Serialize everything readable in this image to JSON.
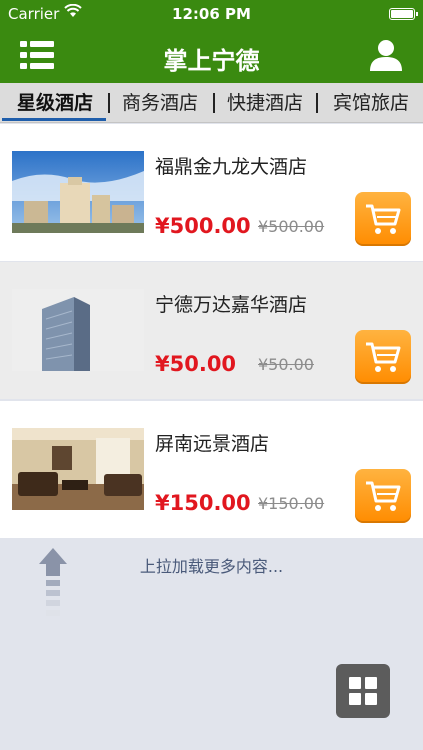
{
  "status_bar": {
    "carrier": "Carrier",
    "time": "12:06 PM"
  },
  "nav": {
    "title": "掌上宁德"
  },
  "tabs": [
    {
      "label": "星级酒店",
      "active": true
    },
    {
      "label": "商务酒店",
      "active": false
    },
    {
      "label": "快捷酒店",
      "active": false
    },
    {
      "label": "宾馆旅店",
      "active": false
    }
  ],
  "hotels": [
    {
      "name": "福鼎金九龙大酒店",
      "price": "¥500.00",
      "original_price": "¥500.00"
    },
    {
      "name": "宁德万达嘉华酒店",
      "price": "¥50.00",
      "original_price": "¥50.00"
    },
    {
      "name": "屏南远景酒店",
      "price": "¥150.00",
      "original_price": "¥150.00"
    }
  ],
  "load_more": {
    "text": "上拉加载更多内容..."
  },
  "colors": {
    "brand_green": "#3a8a10",
    "price_red": "#e1171f",
    "cart_orange": "#ff8c00",
    "tab_active": "#1f5eab"
  }
}
